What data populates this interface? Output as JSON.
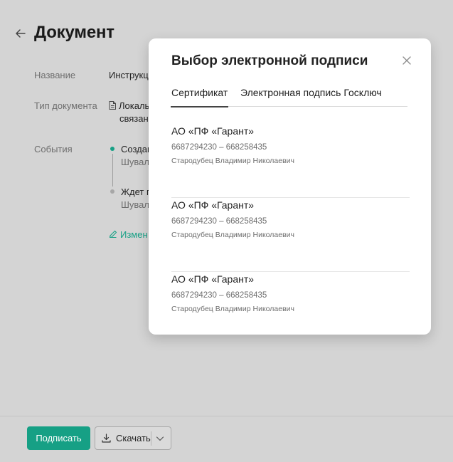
{
  "page": {
    "title": "Документ",
    "fields": {
      "name_label": "Название",
      "name_value": "Инструкц",
      "type_label": "Тип документа",
      "type_value_line1": "Локаль",
      "type_value_line2": "связан",
      "events_label": "События"
    },
    "events": [
      {
        "title": "Создан",
        "sub": "Шувал"
      },
      {
        "title": "Ждет п",
        "sub": "Шувал"
      }
    ],
    "edit_link": "Измен",
    "icons": {
      "back": "arrow-left-icon",
      "doc": "document-icon",
      "edit": "pencil-icon"
    }
  },
  "footer": {
    "sign_label": "Подписать",
    "download_label": "Скачать",
    "icons": {
      "download": "download-icon",
      "chevron": "chevron-down-icon"
    }
  },
  "modal": {
    "title": "Выбор электронной подписи",
    "close_icon": "close-icon",
    "tabs": [
      {
        "label": "Сертификат",
        "active": true
      },
      {
        "label": "Электронная подпись Госключ",
        "active": false
      }
    ],
    "certificates": [
      {
        "name": "АО «ПФ «Гарант»",
        "ids": "6687294230 – 668258435",
        "owner": "Стародубец Владимир Николаевич"
      },
      {
        "name": "АО «ПФ «Гарант»",
        "ids": "6687294230 – 668258435",
        "owner": "Стародубец Владимир Николаевич"
      },
      {
        "name": "АО «ПФ «Гарант»",
        "ids": "6687294230 – 668258435",
        "owner": "Стародубец Владимир Николаевич"
      }
    ]
  },
  "colors": {
    "accent": "#16a085",
    "overlay_bg": "#d4d4d4",
    "modal_bg": "#ffffff"
  }
}
